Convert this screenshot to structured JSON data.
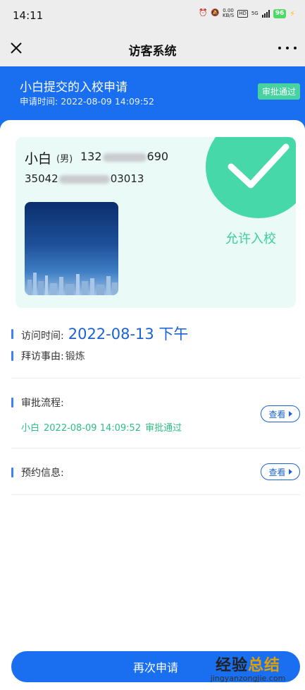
{
  "status_bar": {
    "time": "14:11",
    "net_speed": "0.00",
    "net_unit": "KB/S",
    "hd": "HD",
    "network": "5G",
    "battery": "96"
  },
  "nav": {
    "title": "访客系统"
  },
  "header": {
    "title": "小白提交的入校申请",
    "time_label": "申请时间:",
    "time_value": "2022-08-09 14:09:52",
    "status": "审批通过"
  },
  "pass": {
    "name": "小白",
    "gender": "(男)",
    "phone_prefix": "132",
    "phone_suffix": "690",
    "id_prefix": "35042",
    "id_suffix": "03013",
    "result": "允许入校"
  },
  "visit": {
    "time_label": "访问时间:",
    "time_value": "2022-08-13 下午",
    "reason_label": "拜访事由:",
    "reason_value": "锻炼"
  },
  "approval": {
    "label": "审批流程:",
    "entry_name": "小白",
    "entry_time": "2022-08-09 14:09:52",
    "entry_status": "审批通过",
    "view_label": "查看"
  },
  "booking": {
    "label": "预约信息:",
    "view_label": "查看"
  },
  "footer": {
    "button": "再次申请"
  },
  "watermark": {
    "cn_1": "经验",
    "cn_2": "总结",
    "url": "jingyanzongjie.com"
  },
  "colors": {
    "primary": "#1a6ff0",
    "success": "#46d8a8",
    "card_bg": "#eafaf6"
  }
}
